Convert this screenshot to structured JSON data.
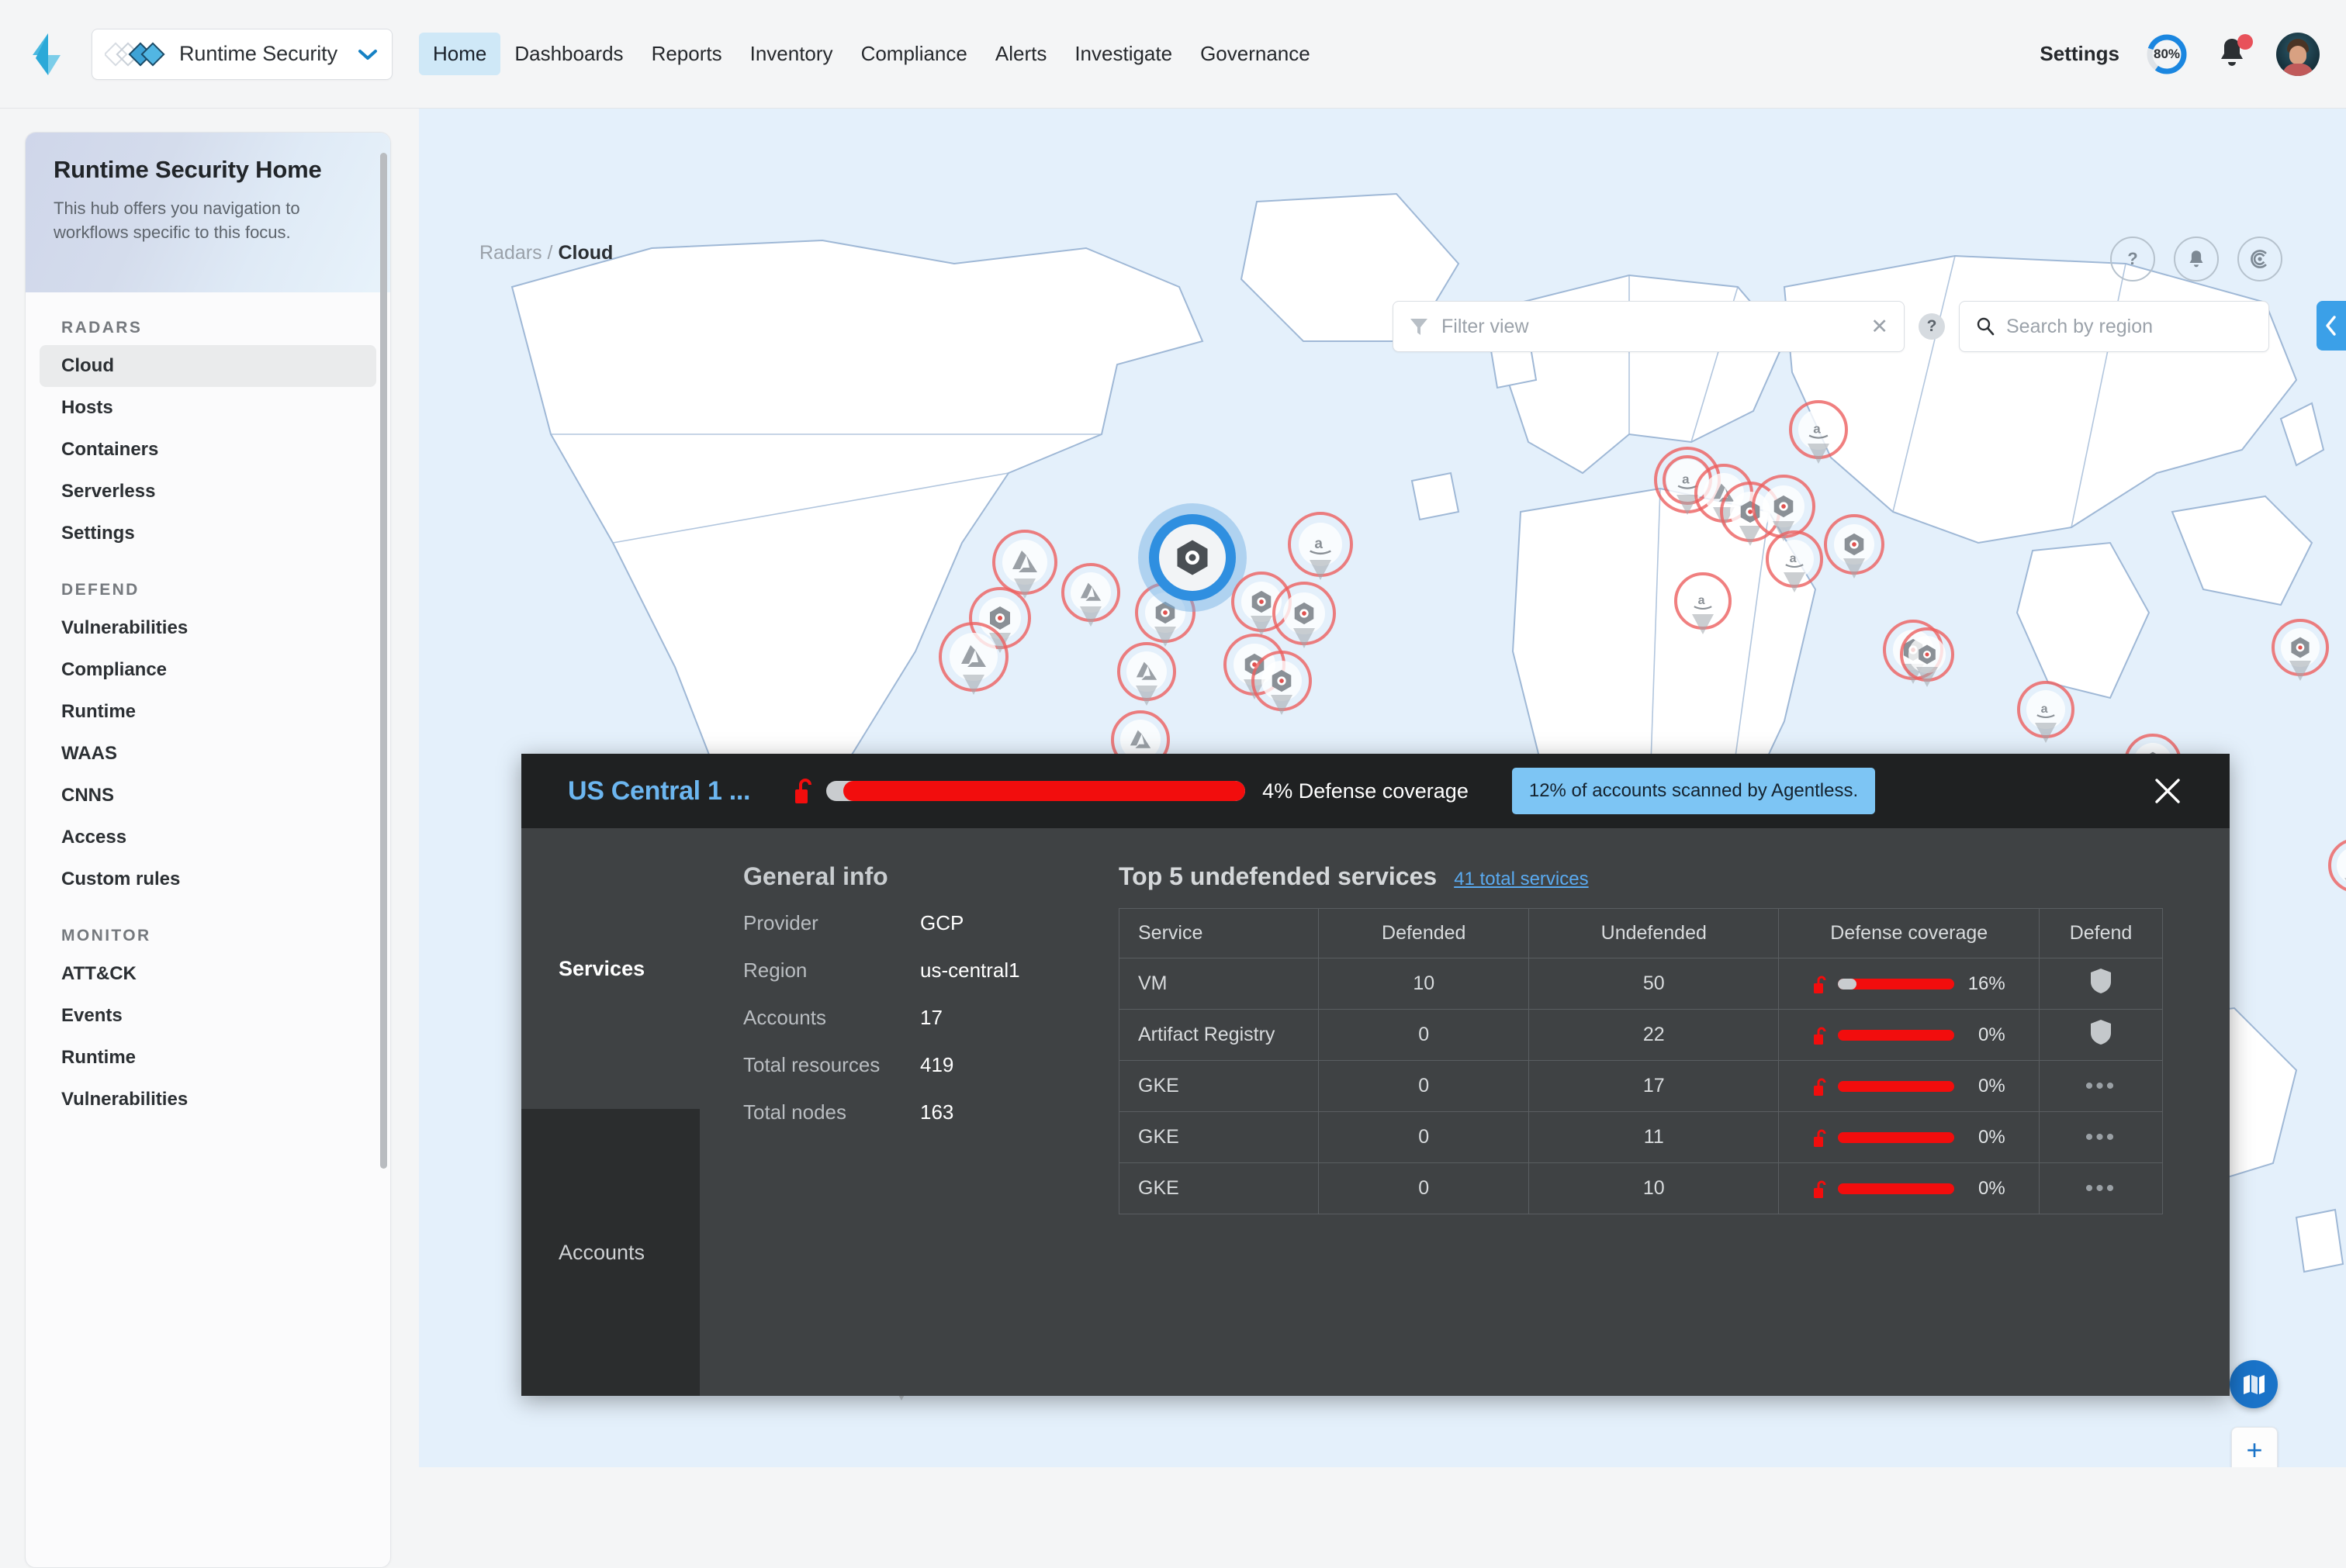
{
  "app": {
    "focus_label": "Runtime Security",
    "settings_label": "Settings",
    "progress_badge": "80%"
  },
  "nav": {
    "items": [
      {
        "label": "Home",
        "active": true
      },
      {
        "label": "Dashboards",
        "active": false
      },
      {
        "label": "Reports",
        "active": false
      },
      {
        "label": "Inventory",
        "active": false
      },
      {
        "label": "Compliance",
        "active": false
      },
      {
        "label": "Alerts",
        "active": false
      },
      {
        "label": "Investigate",
        "active": false
      },
      {
        "label": "Governance",
        "active": false
      }
    ]
  },
  "sidebar": {
    "title": "Runtime Security Home",
    "subtitle": "This hub offers you navigation to workflows specific to this focus.",
    "groups": [
      {
        "heading": "RADARS",
        "items": [
          {
            "label": "Cloud",
            "active": true
          },
          {
            "label": "Hosts",
            "active": false
          },
          {
            "label": "Containers",
            "active": false
          },
          {
            "label": "Serverless",
            "active": false
          },
          {
            "label": "Settings",
            "active": false
          }
        ]
      },
      {
        "heading": "DEFEND",
        "items": [
          {
            "label": "Vulnerabilities",
            "active": false
          },
          {
            "label": "Compliance",
            "active": false
          },
          {
            "label": "Runtime",
            "active": false
          },
          {
            "label": "WAAS",
            "active": false
          },
          {
            "label": "CNNS",
            "active": false
          },
          {
            "label": "Access",
            "active": false
          },
          {
            "label": "Custom rules",
            "active": false
          }
        ]
      },
      {
        "heading": "MONITOR",
        "items": [
          {
            "label": "ATT&CK",
            "active": false
          },
          {
            "label": "Events",
            "active": false
          },
          {
            "label": "Runtime",
            "active": false
          },
          {
            "label": "Vulnerabilities",
            "active": false
          }
        ]
      }
    ]
  },
  "map": {
    "breadcrumb_parent": "Radars /",
    "breadcrumb_current": "Cloud",
    "filter_placeholder": "Filter view",
    "search_placeholder": "Search by region",
    "zoom_in_label": "+",
    "zoom_out_label": "−"
  },
  "panel": {
    "title": "US Central 1 ...",
    "coverage_percent": 4,
    "coverage_label": "4% Defense coverage",
    "agentless_badge": "12% of accounts scanned by Agentless.",
    "tabs": [
      {
        "label": "Services",
        "active": true
      },
      {
        "label": "Accounts",
        "active": false
      }
    ],
    "general_info": {
      "heading": "General info",
      "rows": [
        {
          "key": "Provider",
          "value": "GCP"
        },
        {
          "key": "Region",
          "value": "us-central1"
        },
        {
          "key": "Accounts",
          "value": "17"
        },
        {
          "key": "Total resources",
          "value": "419"
        },
        {
          "key": "Total nodes",
          "value": "163"
        }
      ]
    },
    "services": {
      "heading": "Top 5 undefended services",
      "total_link": "41 total services",
      "columns": [
        "Service",
        "Defended",
        "Undefended",
        "Defense coverage",
        "Defend"
      ],
      "rows": [
        {
          "service": "VM",
          "defended": "10",
          "undefended": "50",
          "coverage": 16,
          "coverage_label": "16%",
          "action": "shield"
        },
        {
          "service": "Artifact Registry",
          "defended": "0",
          "undefended": "22",
          "coverage": 0,
          "coverage_label": "0%",
          "action": "shield"
        },
        {
          "service": "GKE",
          "defended": "0",
          "undefended": "17",
          "coverage": 0,
          "coverage_label": "0%",
          "action": "dots"
        },
        {
          "service": "GKE",
          "defended": "0",
          "undefended": "11",
          "coverage": 0,
          "coverage_label": "0%",
          "action": "dots"
        },
        {
          "service": "GKE",
          "defended": "0",
          "undefended": "10",
          "coverage": 0,
          "coverage_label": "0%",
          "action": "dots"
        }
      ]
    }
  },
  "colors": {
    "accent_blue": "#1a73c8",
    "danger_red": "#f20d0d",
    "panel_dark": "#3f4244",
    "panel_header": "#1f2122",
    "link_blue": "#6cb6f0"
  }
}
